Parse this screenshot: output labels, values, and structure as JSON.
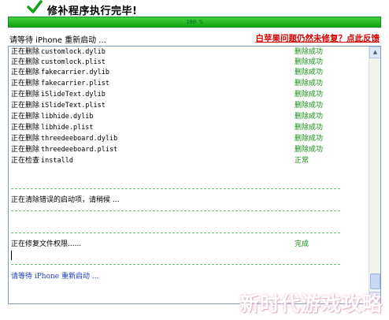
{
  "header": {
    "title": "修补程序执行完毕!"
  },
  "progress": {
    "label": "100 %",
    "value": 100
  },
  "status_line": "请等待 iPhone 重新启动 ...",
  "feedback_link": "白苹果问题仍然未修复？点此反馈",
  "log": {
    "lines": [
      {
        "action": "正在删除",
        "file": "customlock.dylib",
        "result": "删除成功"
      },
      {
        "action": "正在删除",
        "file": "customlock.plist",
        "result": "删除成功"
      },
      {
        "action": "正在删除",
        "file": "fakecarrier.dylib",
        "result": "删除成功"
      },
      {
        "action": "正在删除",
        "file": "fakecarrier.plist",
        "result": "删除成功"
      },
      {
        "action": "正在删除",
        "file": "iSlideText.dylib",
        "result": "删除成功"
      },
      {
        "action": "正在删除",
        "file": "iSlideText.plist",
        "result": "删除成功"
      },
      {
        "action": "正在删除",
        "file": "libhide.dylib",
        "result": "删除成功"
      },
      {
        "action": "正在删除",
        "file": "libhide.plist",
        "result": "删除成功"
      },
      {
        "action": "正在删除",
        "file": "threedeeboard.dylib",
        "result": "删除成功"
      },
      {
        "action": "正在删除",
        "file": "threedeeboard.plist",
        "result": "删除成功"
      },
      {
        "action": "正在检查",
        "file": "installd",
        "result": "正常"
      }
    ],
    "clearing": "正在清除错误的启动项，请稍候 ...",
    "repairing": "正在修复文件权限......",
    "repairing_result": "完成",
    "waiting": "请等待 iPhone 重新启动 ..."
  },
  "scrollbar": {
    "up_icon": "▲",
    "down_icon": "▼"
  },
  "watermark": "新时代游戏攻略",
  "colors": {
    "progress": "#1fb21f",
    "success": "#138d13",
    "feedback": "#d40000",
    "info": "#1a3dbf"
  }
}
